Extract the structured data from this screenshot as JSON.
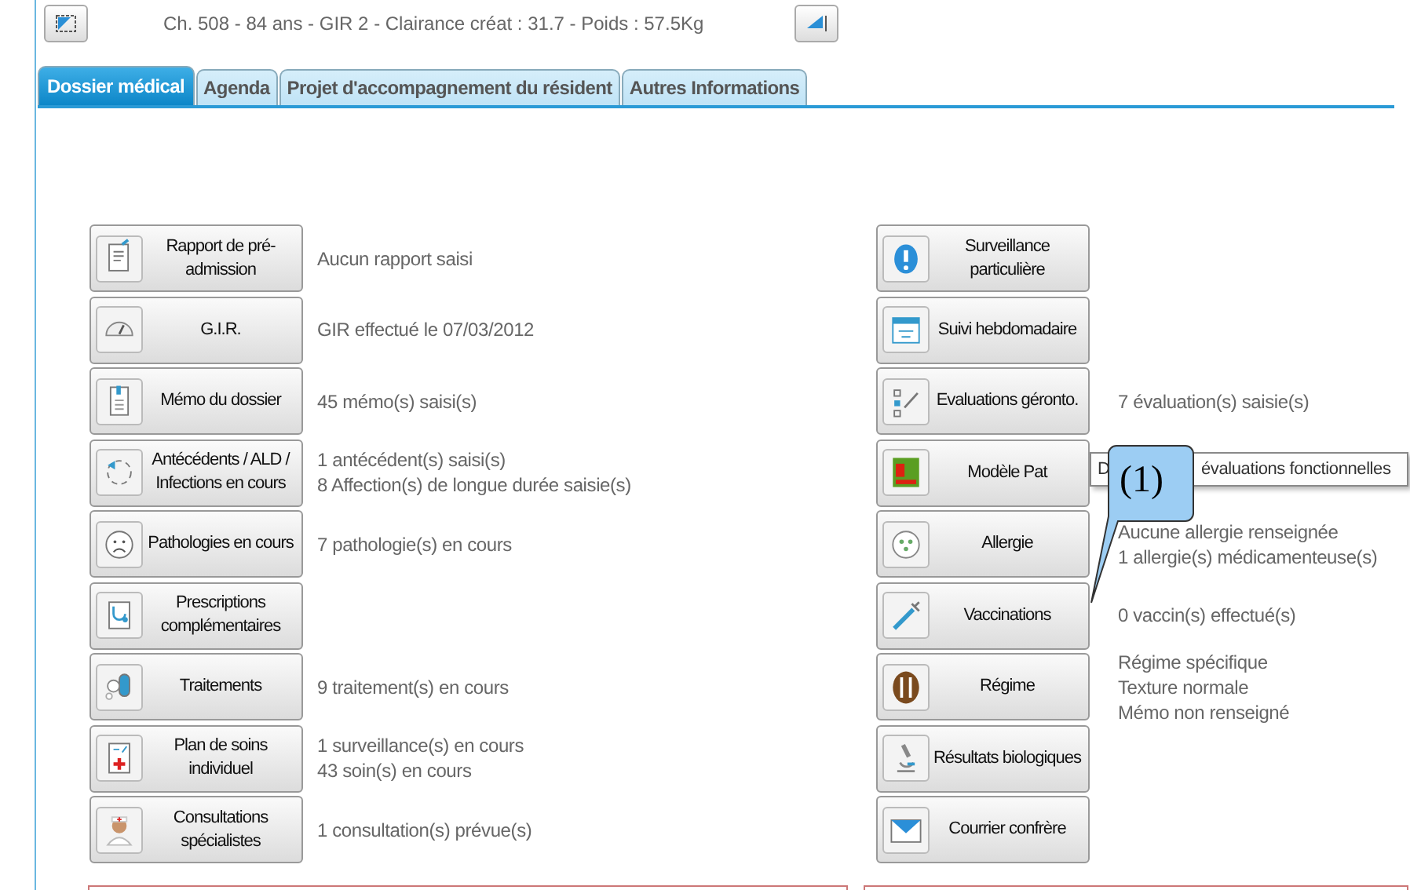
{
  "header": {
    "info": "Ch. 508 - 84 ans - GIR 2 - Clairance créat : 31.7 - Poids : 57.5Kg"
  },
  "tabs": [
    {
      "label": "Dossier médical",
      "selected": true
    },
    {
      "label": "Agenda",
      "selected": false
    },
    {
      "label": "Projet d'accompagnement du résident",
      "selected": false
    },
    {
      "label": "Autres Informations",
      "selected": false
    }
  ],
  "left_items": [
    {
      "label": "Rapport de pré-admission",
      "kind": "report",
      "lines": [
        "Aucun rapport saisi"
      ]
    },
    {
      "label": "G.I.R.",
      "kind": "gauge",
      "lines": [
        "GIR effectué le 07/03/2012"
      ]
    },
    {
      "label": "Mémo du dossier",
      "kind": "memo",
      "lines": [
        "45 mémo(s) saisi(s)"
      ]
    },
    {
      "label": "Antécédents / ALD / Infections en cours",
      "kind": "history",
      "lines": [
        "1 antécédent(s) saisi(s)",
        "8 Affection(s) de longue durée saisie(s)"
      ]
    },
    {
      "label": "Pathologies en cours",
      "kind": "sad",
      "lines": [
        "7 pathologie(s) en cours"
      ]
    },
    {
      "label": "Prescriptions complémentaires",
      "kind": "stethoscope"
    },
    {
      "label": "Traitements",
      "kind": "pills",
      "lines": [
        "9 traitement(s) en cours"
      ]
    },
    {
      "label": "Plan de soins individuel",
      "kind": "care",
      "lines": [
        "1 surveillance(s) en cours",
        "43 soin(s) en cours"
      ]
    },
    {
      "label": "Consultations spécialistes",
      "kind": "nurse",
      "lines": [
        "1 consultation(s) prévue(s)"
      ]
    }
  ],
  "right_items": [
    {
      "label": "Surveillance particulière",
      "kind": "alert"
    },
    {
      "label": "Suivi hebdomadaire",
      "kind": "calendar"
    },
    {
      "label": "Evaluations géronto.",
      "kind": "checklist",
      "lines": [
        "7 évaluation(s) saisie(s)"
      ]
    },
    {
      "label": "Modèle Pat",
      "kind": "pathos"
    },
    {
      "label": "Allergie",
      "kind": "allergy",
      "lines": [
        "Aucune allergie renseignée",
        "1 allergie(s) médicamenteuse(s)"
      ]
    },
    {
      "label": "Vaccinations",
      "kind": "syringe",
      "lines": [
        "0 vaccin(s) effectué(s)"
      ]
    },
    {
      "label": "Régime",
      "kind": "cutlery",
      "lines": [
        "Régime spécifique",
        "Texture normale",
        "Mémo non renseigné"
      ]
    },
    {
      "label": "Résultats biologiques",
      "kind": "microscope"
    },
    {
      "label": "Courrier confrère",
      "kind": "mail"
    }
  ],
  "tooltip": {
    "start": "D",
    "end": "évaluations fonctionnelles"
  },
  "callout": {
    "label": "(1)"
  }
}
